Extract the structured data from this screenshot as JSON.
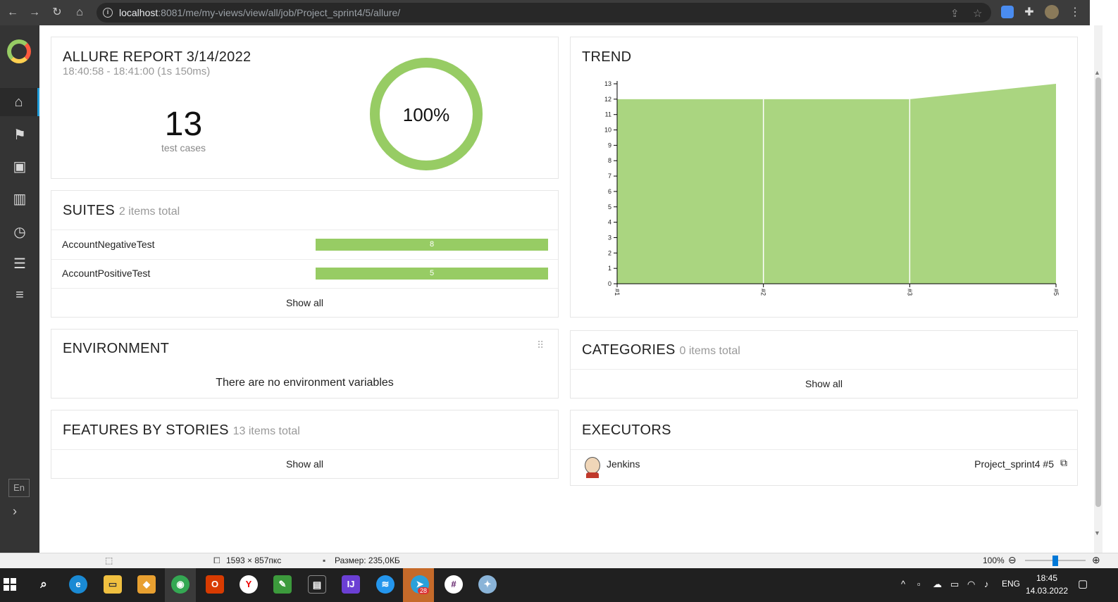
{
  "browser": {
    "url_host": "localhost",
    "url_rest": ":8081/me/my-views/view/all/job/Project_sprint4/5/allure/"
  },
  "sidebar": {
    "items": [
      {
        "name": "home-icon",
        "glyph": "⌂"
      },
      {
        "name": "flag-icon",
        "glyph": "⚑"
      },
      {
        "name": "briefcase-icon",
        "glyph": "▣"
      },
      {
        "name": "bar-chart-icon",
        "glyph": "▥"
      },
      {
        "name": "clock-icon",
        "glyph": "◷"
      },
      {
        "name": "list-icon",
        "glyph": "☰"
      },
      {
        "name": "menu-icon",
        "glyph": "≡"
      }
    ],
    "lang": "En"
  },
  "summary": {
    "title": "ALLURE REPORT 3/14/2022",
    "time": "18:40:58 - 18:41:00 (1s 150ms)",
    "count": "13",
    "count_label": "test cases",
    "percent": "100%",
    "passed_fraction": 1.0
  },
  "suites": {
    "title": "SUITES",
    "subtitle": "2 items total",
    "items": [
      {
        "name": "AccountNegativeTest",
        "count": "8"
      },
      {
        "name": "AccountPositiveTest",
        "count": "5"
      }
    ],
    "show_all": "Show all"
  },
  "environment": {
    "title": "ENVIRONMENT",
    "empty_text": "There are no environment variables"
  },
  "features": {
    "title": "FEATURES BY STORIES",
    "subtitle": "13 items total",
    "show_all": "Show all"
  },
  "trend": {
    "title": "TREND"
  },
  "chart_data": {
    "type": "area",
    "title": "TREND",
    "x": [
      "#1",
      "#2",
      "#3",
      "#5"
    ],
    "series": [
      {
        "values": [
          12,
          12,
          12,
          13
        ]
      }
    ],
    "ylim": [
      0,
      13
    ],
    "yticks": [
      "0",
      "1",
      "2",
      "3",
      "4",
      "5",
      "6",
      "7",
      "8",
      "9",
      "10",
      "11",
      "12",
      "13"
    ],
    "color": "#aad580"
  },
  "categories": {
    "title": "CATEGORIES",
    "subtitle": "0 items total",
    "show_all": "Show all"
  },
  "executors": {
    "title": "EXECUTORS",
    "name": "Jenkins",
    "build": "Project_sprint4 #5"
  },
  "statusbar": {
    "dimensions": "1593 × 857пкс",
    "size": "Размер: 235,0КБ",
    "zoom": "100%"
  },
  "taskbar": {
    "lang": "ENG",
    "time": "18:45",
    "date": "14.03.2022",
    "badge": "28"
  },
  "colors": {
    "passed": "#97cc64",
    "sidebar": "#343434"
  }
}
